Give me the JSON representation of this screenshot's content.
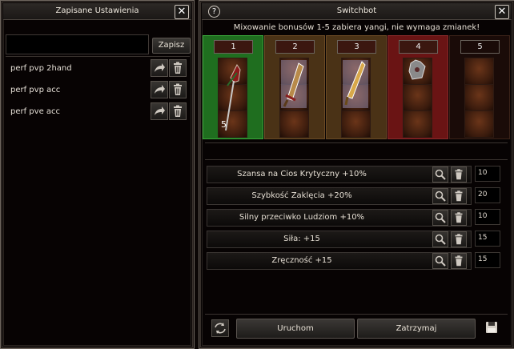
{
  "left_window": {
    "title": "Zapisane Ustawienia",
    "close": "✕",
    "save_label": "Zapisz",
    "name_input_value": "",
    "items": [
      {
        "label": "perf pvp 2hand"
      },
      {
        "label": "perf pvp acc"
      },
      {
        "label": "perf pve acc"
      }
    ]
  },
  "right_window": {
    "title": "Switchbot",
    "help": "?",
    "close": "✕",
    "info": "Mixowanie bonusów 1-5 zabiera yangi, nie wymaga zmianek!",
    "slots": [
      {
        "number": "1",
        "color": "#1f6e1f",
        "count": "5"
      },
      {
        "number": "2",
        "color": "#4a3216"
      },
      {
        "number": "3",
        "color": "#4a3216"
      },
      {
        "number": "4",
        "color": "#6a1414"
      },
      {
        "number": "5",
        "color": "#1a0b08"
      }
    ],
    "bonuses": [
      {
        "label": "Szansa na Cios Krytyczny +10%",
        "value": "10"
      },
      {
        "label": "Szybkość Zaklęcia +20%",
        "value": "20"
      },
      {
        "label": "Silny przeciwko Ludziom +10%",
        "value": "10"
      },
      {
        "label": "Siła: +15",
        "value": "15"
      },
      {
        "label": "Zręczność +15",
        "value": "15"
      }
    ],
    "start_label": "Uruchom",
    "stop_label": "Zatrzymaj"
  },
  "icons": {
    "share": "share-arrow-icon",
    "trash": "trash-icon",
    "search": "magnifier-icon",
    "refresh": "refresh-icon",
    "save": "floppy-disk-icon"
  }
}
